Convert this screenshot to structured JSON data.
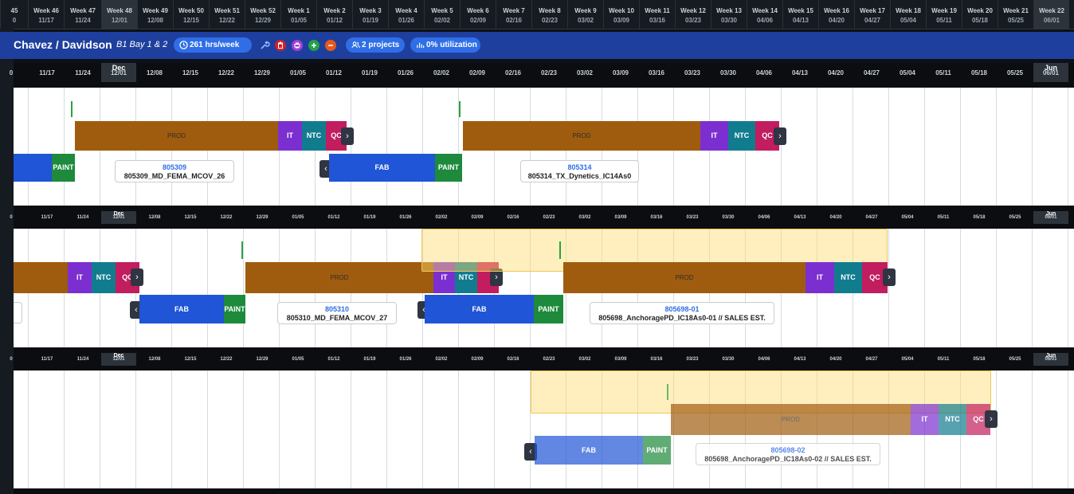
{
  "weeks": [
    {
      "label": "45",
      "date": "0"
    },
    {
      "label": "Week 46",
      "date": "11/17"
    },
    {
      "label": "Week 47",
      "date": "11/24"
    },
    {
      "label": "Week 48",
      "date": "12/01"
    },
    {
      "label": "Week 49",
      "date": "12/08"
    },
    {
      "label": "Week 50",
      "date": "12/15"
    },
    {
      "label": "Week 51",
      "date": "12/22"
    },
    {
      "label": "Week 52",
      "date": "12/29"
    },
    {
      "label": "Week 1",
      "date": "01/05"
    },
    {
      "label": "Week 2",
      "date": "01/12"
    },
    {
      "label": "Week 3",
      "date": "01/19"
    },
    {
      "label": "Week 4",
      "date": "01/26"
    },
    {
      "label": "Week 5",
      "date": "02/02"
    },
    {
      "label": "Week 6",
      "date": "02/09"
    },
    {
      "label": "Week 7",
      "date": "02/16"
    },
    {
      "label": "Week 8",
      "date": "02/23"
    },
    {
      "label": "Week 9",
      "date": "03/02"
    },
    {
      "label": "Week 10",
      "date": "03/09"
    },
    {
      "label": "Week 11",
      "date": "03/16"
    },
    {
      "label": "Week 12",
      "date": "03/23"
    },
    {
      "label": "Week 13",
      "date": "03/30"
    },
    {
      "label": "Week 14",
      "date": "04/06"
    },
    {
      "label": "Week 15",
      "date": "04/13"
    },
    {
      "label": "Week 16",
      "date": "04/20"
    },
    {
      "label": "Week 17",
      "date": "04/27"
    },
    {
      "label": "Week 18",
      "date": "05/04"
    },
    {
      "label": "Week 19",
      "date": "05/11"
    },
    {
      "label": "Week 20",
      "date": "05/18"
    },
    {
      "label": "Week 21",
      "date": "05/25"
    },
    {
      "label": "Week 22",
      "date": "06/01"
    }
  ],
  "dates": [
    "0",
    "11/17",
    "11/24",
    "12/01",
    "12/08",
    "12/15",
    "12/22",
    "12/29",
    "01/05",
    "01/12",
    "01/19",
    "01/26",
    "02/02",
    "02/09",
    "02/16",
    "02/23",
    "03/02",
    "03/09",
    "03/16",
    "03/23",
    "03/30",
    "04/06",
    "04/13",
    "04/20",
    "04/27",
    "05/04",
    "05/11",
    "05/18",
    "05/25",
    "06/01"
  ],
  "months": [
    {
      "label": "Dec",
      "at": 3
    },
    {
      "label": "Jun",
      "at": 29
    }
  ],
  "toolbar": {
    "title": "Chavez / Davidson",
    "subtitle": "B1 Bay 1 & 2",
    "hours": "261 hrs/week",
    "projects": "2 projects",
    "utilization": "0% utilization"
  },
  "colors": {
    "prod": "#a05c0e",
    "it": "#7c2fd0",
    "ntc": "#127c8f",
    "qc": "#c21d5e",
    "fab": "#1f55d6",
    "paint": "#1d8a3c",
    "header": "#1f3f9e"
  },
  "projects": [
    {
      "number": "805309",
      "name": "805309_MD_FEMA_MCOV_26"
    },
    {
      "number": "805314",
      "name": "805314_TX_Dynetics_IC14As0"
    },
    {
      "number": "805310",
      "name": "805310_MD_FEMA_MCOV_27"
    },
    {
      "number": "805698-01",
      "name": "805698_AnchoragePD_IC18As0-01 // SALES EST."
    },
    {
      "number": "805698-02",
      "name": "805698_AnchoragePD_IC18As0-02 // SALES EST."
    }
  ],
  "phases": {
    "prod": "PROD",
    "it": "IT",
    "ntc": "NTC",
    "qc": "QC",
    "fab": "FAB",
    "paint": "PAINT"
  }
}
